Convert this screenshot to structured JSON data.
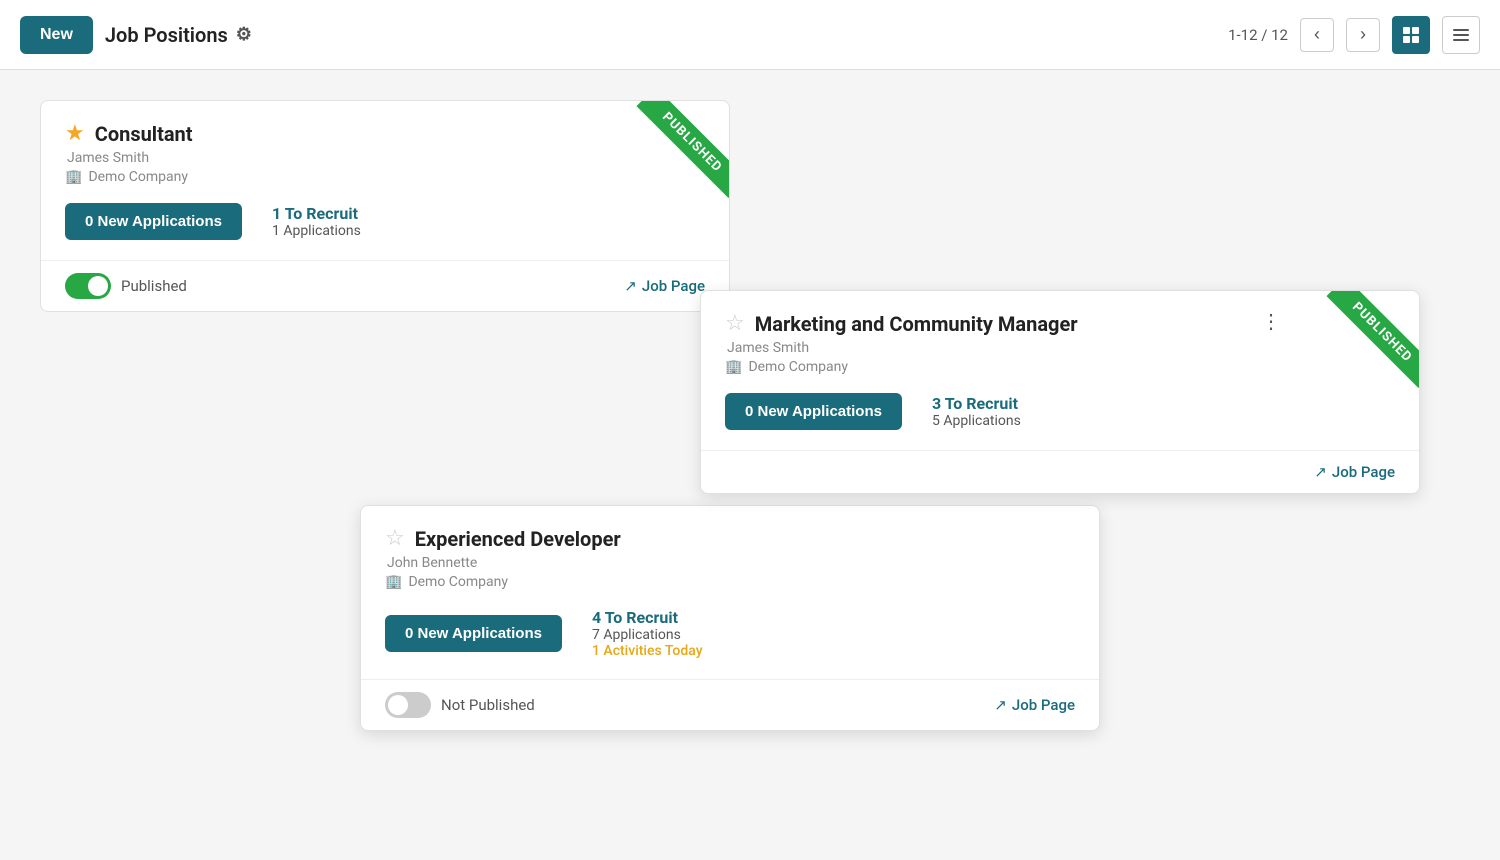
{
  "header": {
    "new_label": "New",
    "title": "Job Positions",
    "pagination": "1-12 / 12",
    "gear_symbol": "⚙"
  },
  "cards": {
    "consultant": {
      "title": "Consultant",
      "person": "James Smith",
      "company": "Demo Company",
      "new_apps_label": "0 New Applications",
      "recruit_count": "1 To Recruit",
      "applications": "1 Applications",
      "is_published": true,
      "published_label": "Published",
      "job_page_label": "Job Page",
      "ribbon_text": "PUBLISHED",
      "star_filled": true
    },
    "marketing": {
      "title": "Marketing and Community Manager",
      "person": "James Smith",
      "company": "Demo Company",
      "new_apps_label": "0 New Applications",
      "recruit_count": "3 To Recruit",
      "applications": "5 Applications",
      "is_published": true,
      "job_page_label": "Job Page",
      "ribbon_text": "PUBLISHED",
      "star_filled": false
    },
    "developer": {
      "title": "Experienced Developer",
      "person": "John Bennette",
      "company": "Demo Company",
      "new_apps_label": "0 New Applications",
      "recruit_count": "4 To Recruit",
      "applications": "7 Applications",
      "activities_today": "1 Activities Today",
      "is_published": false,
      "not_published_label": "Not Published",
      "job_page_label": "Job Page",
      "star_filled": false
    }
  },
  "icons": {
    "building": "🏢",
    "star_filled": "★",
    "star_empty": "☆",
    "external_link": "↗",
    "more": "⋮",
    "prev": "‹",
    "next": "›",
    "grid_view": "▦",
    "list_view": "≡"
  }
}
